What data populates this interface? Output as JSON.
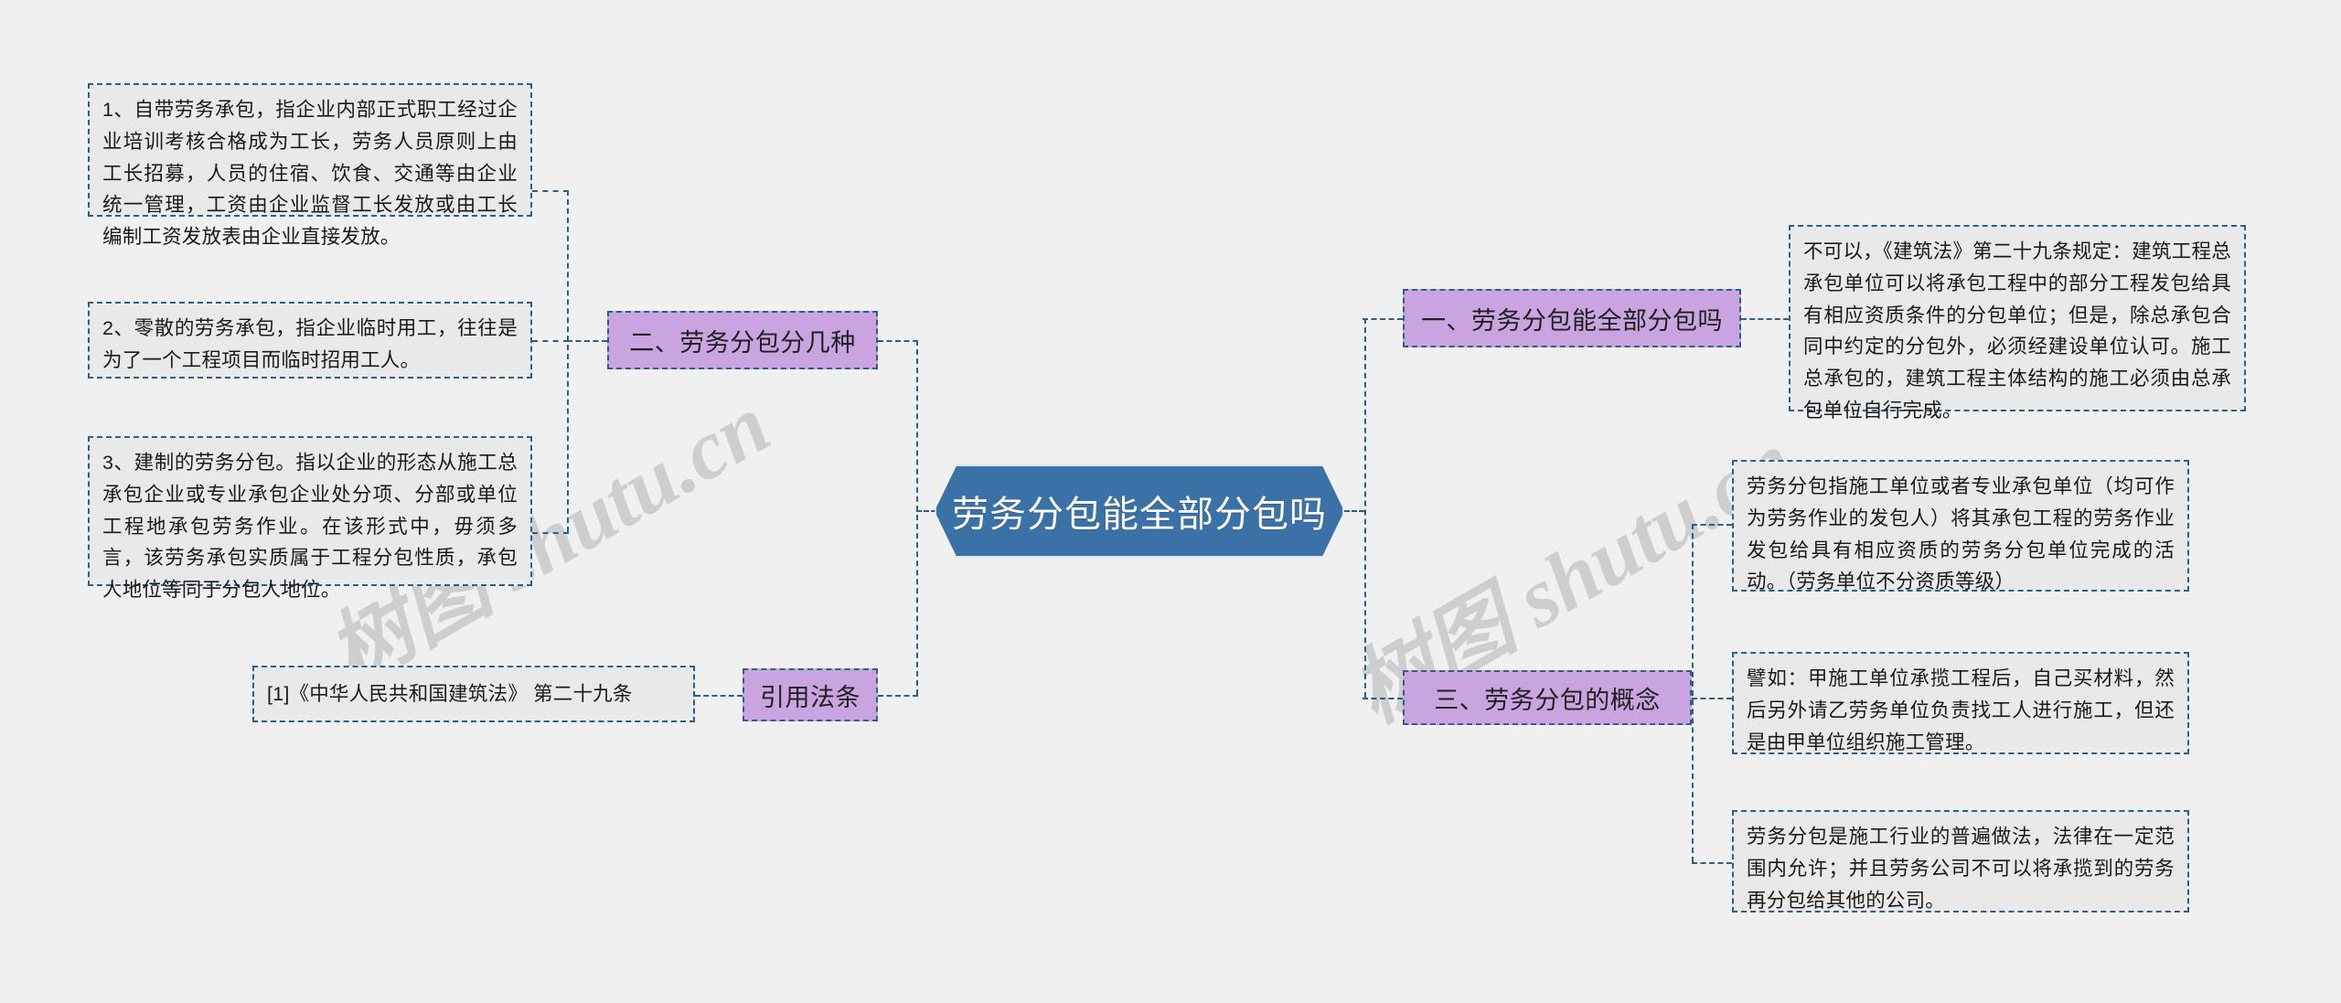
{
  "root": {
    "label": "劳务分包能全部分包吗",
    "fill": "#3a72a8",
    "text_color": "#ffffff"
  },
  "watermark": {
    "text_left": "树图 shutu.cn",
    "text_right": "树图 shutu.cn",
    "color": "#c9c9c9"
  },
  "theme": {
    "background": "#f0f0f0",
    "branch_fill": "#c9a4e0",
    "leaf_fill": "#e9e9e9",
    "line_color": "#2e5f8a"
  },
  "left_branches": [
    {
      "label": "二、劳务分包分几种",
      "children": [
        "1、自带劳务承包，指企业内部正式职工经过企业培训考核合格成为工长，劳务人员原则上由工长招募，人员的住宿、饮食、交通等由企业统一管理，工资由企业监督工长发放或由工长编制工资发放表由企业直接发放。",
        "2、零散的劳务承包，指企业临时用工，往往是为了一个工程项目而临时招用工人。",
        "3、建制的劳务分包。指以企业的形态从施工总承包企业或专业承包企业处分项、分部或单位工程地承包劳务作业。在该形式中，毋须多言，该劳务承包实质属于工程分包性质，承包人地位等同于分包人地位。"
      ]
    },
    {
      "label": "引用法条",
      "children": [
        "[1]《中华人民共和国建筑法》 第二十九条"
      ]
    }
  ],
  "right_branches": [
    {
      "label": "一、劳务分包能全部分包吗",
      "children": [
        "不可以，《建筑法》第二十九条规定：建筑工程总承包单位可以将承包工程中的部分工程发包给具有相应资质条件的分包单位；但是，除总承包合同中约定的分包外，必须经建设单位认可。施工总承包的，建筑工程主体结构的施工必须由总承包单位自行完成。"
      ]
    },
    {
      "label": "三、劳务分包的概念",
      "children": [
        "劳务分包指施工单位或者专业承包单位（均可作为劳务作业的发包人）将其承包工程的劳务作业发包给具有相应资质的劳务分包单位完成的活动。（劳务单位不分资质等级）",
        "譬如：甲施工单位承揽工程后，自己买材料，然后另外请乙劳务单位负责找工人进行施工，但还是由甲单位组织施工管理。",
        "劳务分包是施工行业的普遍做法，法律在一定范围内允许；并且劳务公司不可以将承揽到的劳务再分包给其他的公司。"
      ]
    }
  ]
}
